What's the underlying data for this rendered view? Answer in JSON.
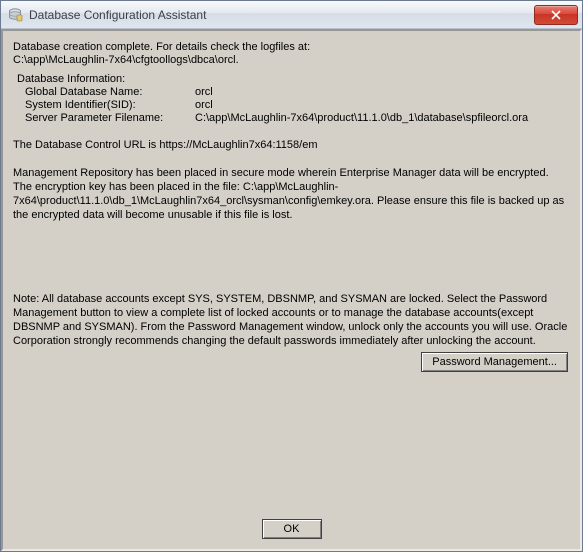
{
  "window": {
    "title": "Database Configuration Assistant"
  },
  "body": {
    "creation_complete": "Database creation complete. For details check the logfiles at:",
    "logfiles_path": " C:\\app\\McLaughlin-7x64\\cfgtoollogs\\dbca\\orcl.",
    "db_info_header": "Database Information:",
    "global_name_label": "Global Database Name:",
    "global_name_value": "orcl",
    "sid_label": "System Identifier(SID):",
    "sid_value": "orcl",
    "spfile_label": "Server Parameter Filename:",
    "spfile_value": "C:\\app\\McLaughlin-7x64\\product\\11.1.0\\db_1\\database\\spfileorcl.ora",
    "control_url_line": "The Database Control URL is https://McLaughlin7x64:1158/em",
    "mgmt_repo_para": "Management Repository has been placed in secure mode wherein Enterprise Manager data will be encrypted.  The encryption key has been placed in the file: C:\\app\\McLaughlin-7x64\\product\\11.1.0\\db_1\\McLaughlin7x64_orcl\\sysman\\config\\emkey.ora.   Please ensure this file is backed up as the encrypted data will become unusable if this file is lost.",
    "note_para": "Note: All database accounts except SYS, SYSTEM, DBSNMP, and SYSMAN are locked. Select the Password Management button to view a complete list of locked accounts or to manage the database accounts(except DBSNMP and SYSMAN). From the Password Management window, unlock only the accounts you will use. Oracle Corporation strongly recommends changing the default passwords immediately after unlocking the account."
  },
  "buttons": {
    "password_mgmt": "Password Management...",
    "ok": "OK"
  }
}
